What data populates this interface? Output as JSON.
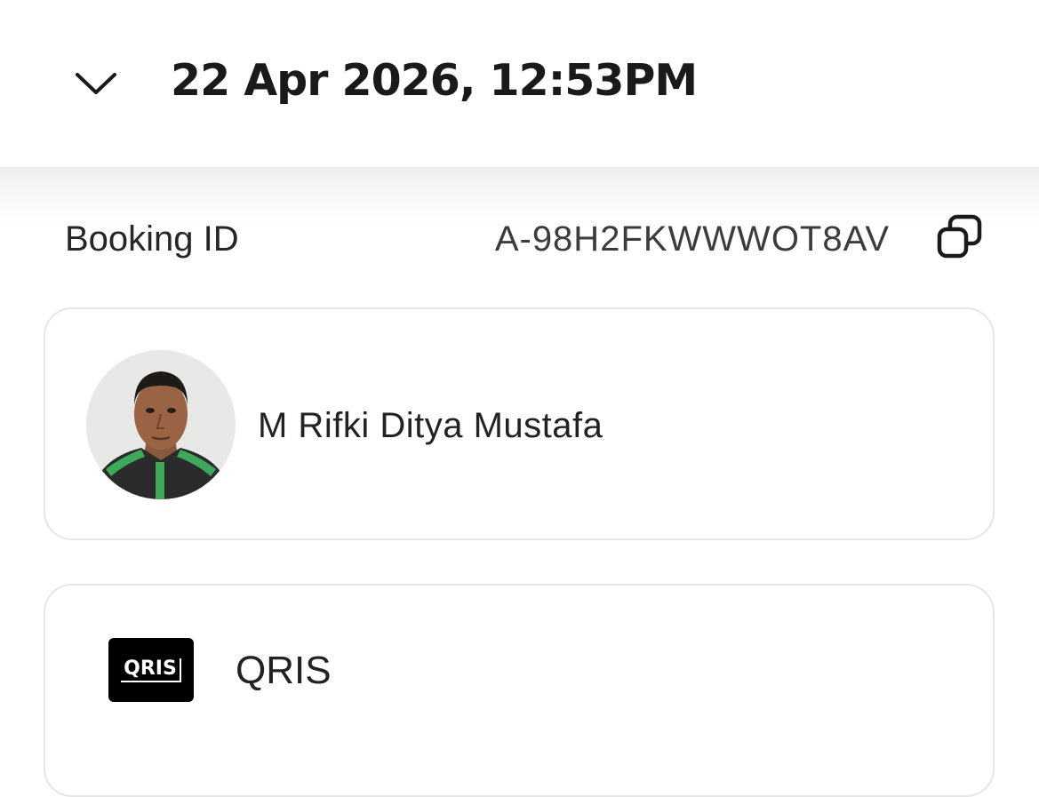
{
  "header": {
    "title": "22 Apr 2026, 12:53PM",
    "collapse_icon": "chevron-down-icon"
  },
  "booking": {
    "label": "Booking ID",
    "value": "A-98H2FKWWWOT8AV",
    "copy_icon": "copy-icon"
  },
  "driver": {
    "name": "M Rifki Ditya Mustafa",
    "avatar": "driver-photo"
  },
  "payment": {
    "method": "QRIS",
    "logo_text": "QRIS"
  },
  "colors": {
    "background": "#ffffff",
    "text": "#1f1f1f",
    "card_border": "#e6e6e6",
    "driver_jacket_green": "#3ea95a"
  }
}
